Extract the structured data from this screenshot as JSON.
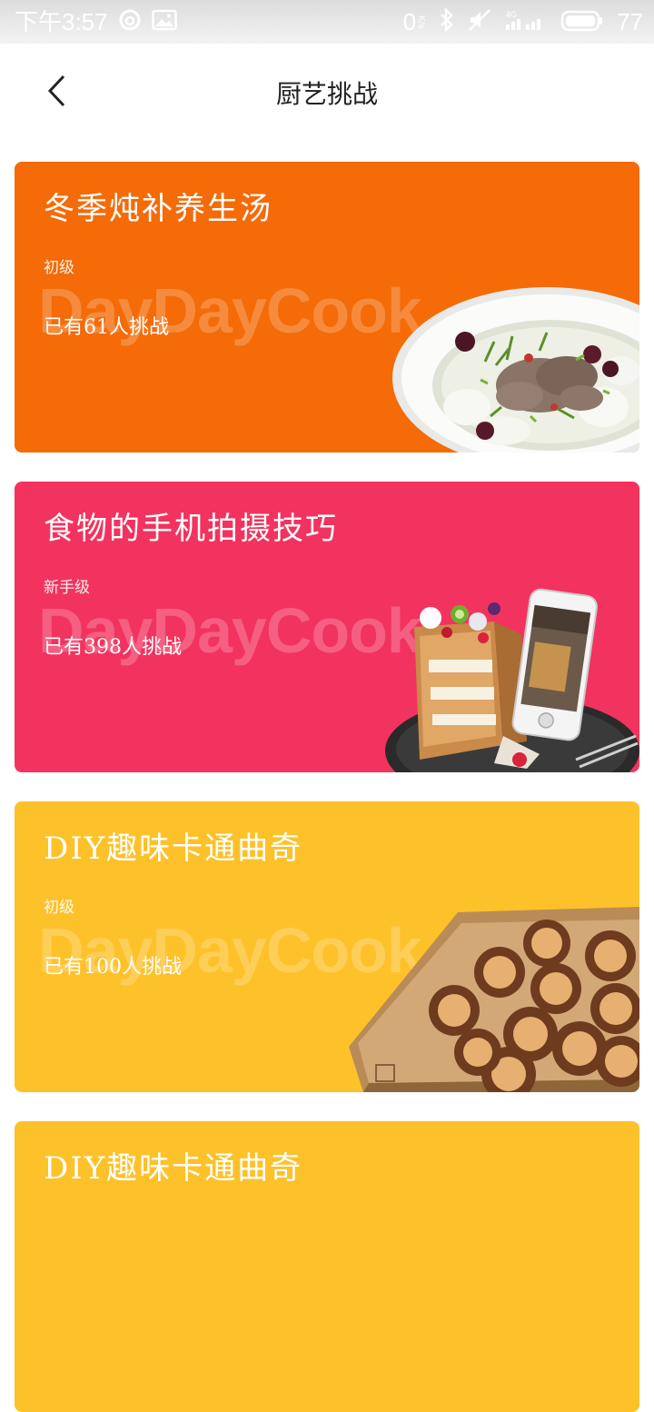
{
  "status_bar": {
    "time": "下午3:57",
    "net_speed": "0",
    "net_unit": "K/s",
    "battery": "77",
    "icons": [
      "netease-music-icon",
      "gallery-icon",
      "bluetooth-icon",
      "mute-icon",
      "signal-4g-icon",
      "battery-icon"
    ]
  },
  "header": {
    "title": "厨艺挑战",
    "back_icon": "chevron-left-icon"
  },
  "cards": [
    {
      "title": "冬季炖补养生汤",
      "level": "初级",
      "watermark": "DayDayCook",
      "count": "已有61人挑战",
      "color": "#f46b08",
      "image": "soup-bowl"
    },
    {
      "title": "食物的手机拍摄技巧",
      "level": "新手级",
      "watermark": "DayDayCook",
      "count": "已有398人挑战",
      "color": "#f2335f",
      "image": "toast-box-and-phone"
    },
    {
      "title": "DIY趣味卡通曲奇",
      "level": "初级",
      "watermark": "DayDayCook",
      "count": "已有100人挑战",
      "color": "#fdc12a",
      "image": "lion-cookies-board"
    },
    {
      "title": "DIY趣味卡通曲奇",
      "color": "#fdc12a"
    }
  ]
}
